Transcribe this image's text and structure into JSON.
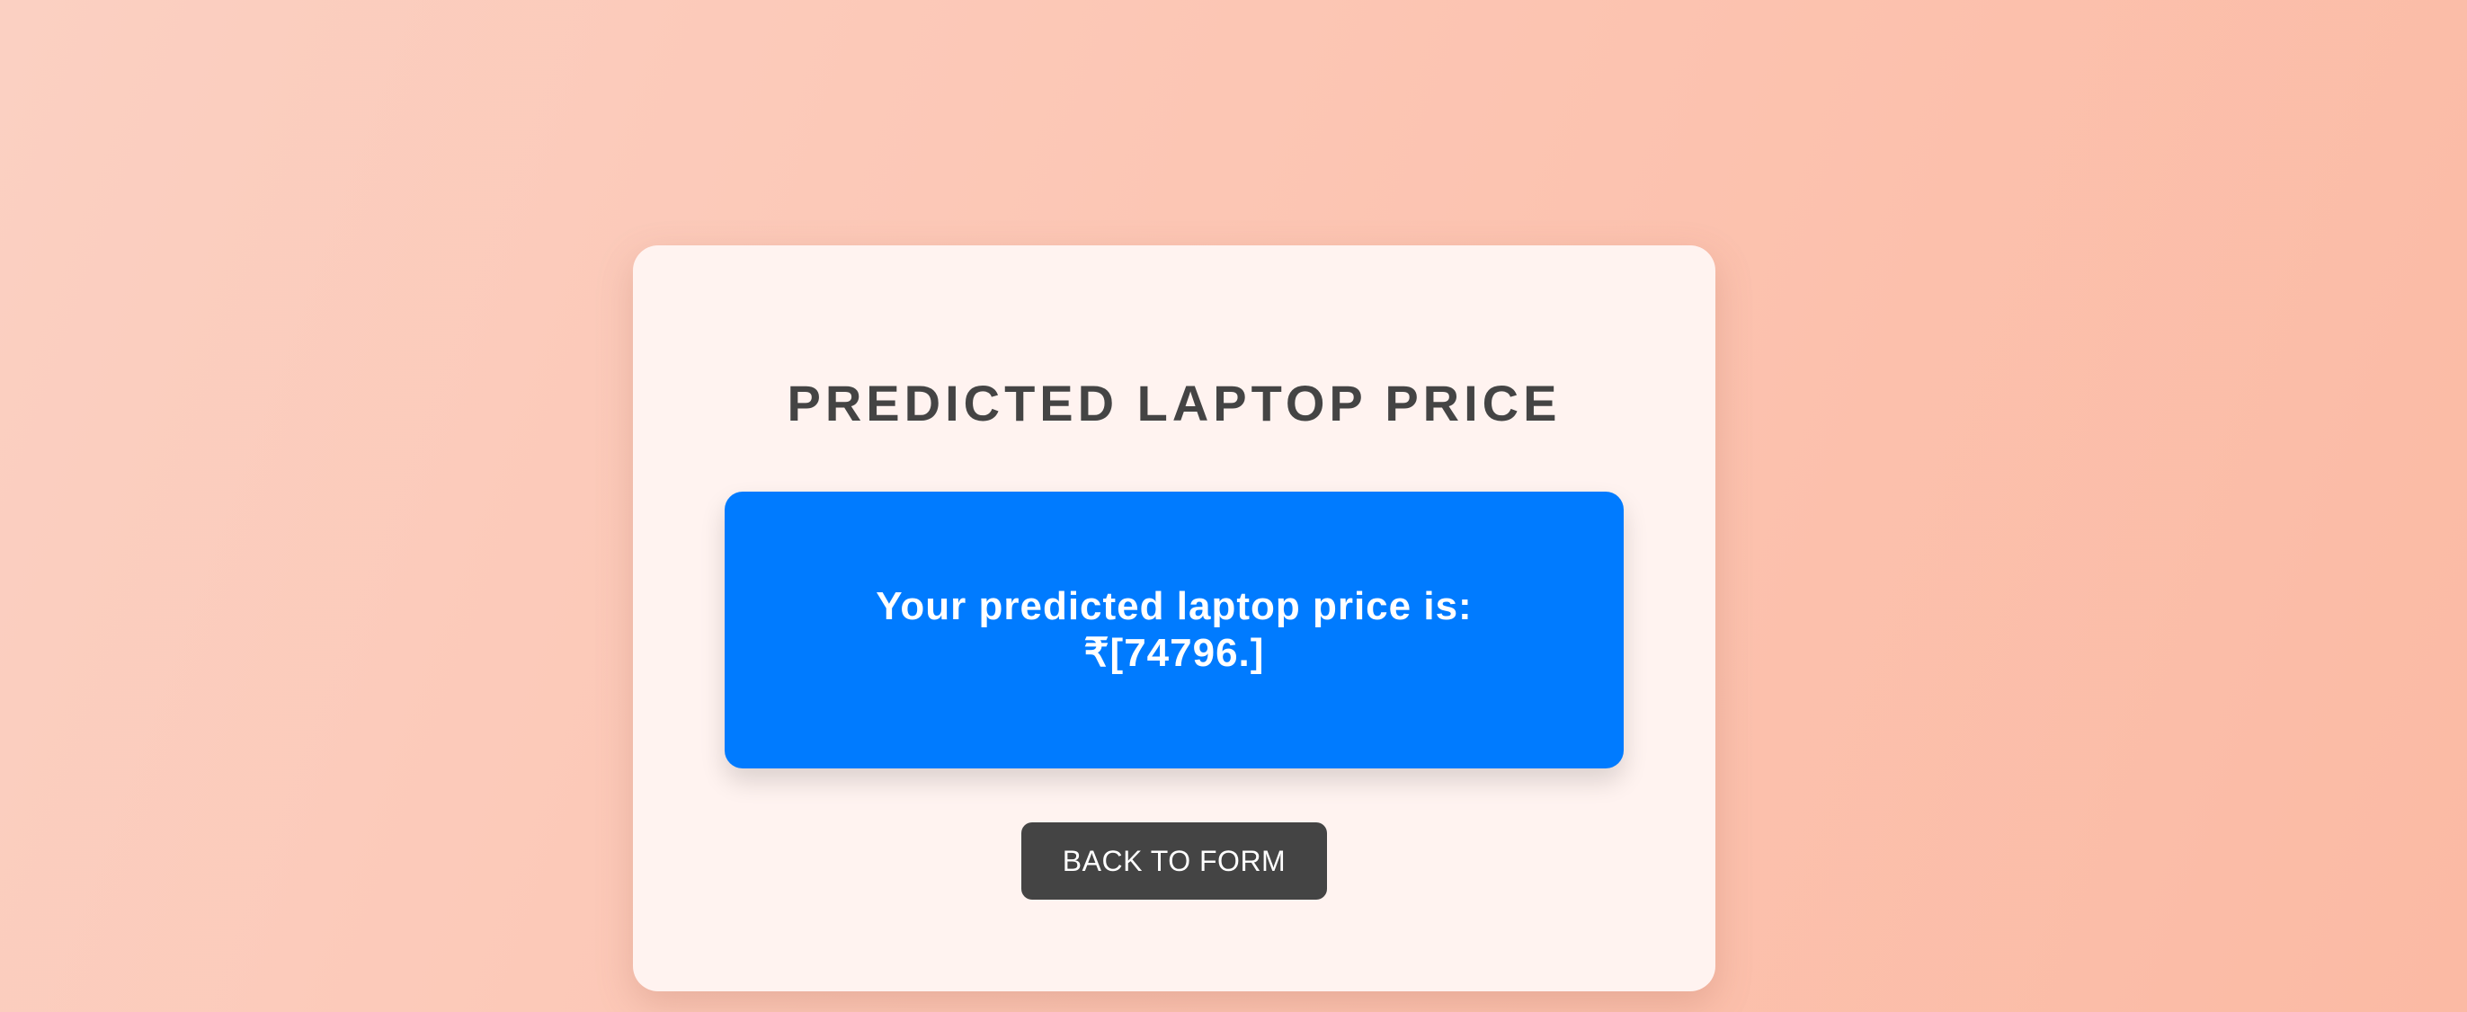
{
  "card": {
    "title": "PREDICTED LAPTOP PRICE",
    "result": {
      "label": "Your predicted laptop price is:",
      "value": "₹[74796.]"
    },
    "back_button_label": "BACK TO FORM"
  },
  "colors": {
    "result_background": "#007bff",
    "button_background": "#444444",
    "title_text": "#444444"
  }
}
